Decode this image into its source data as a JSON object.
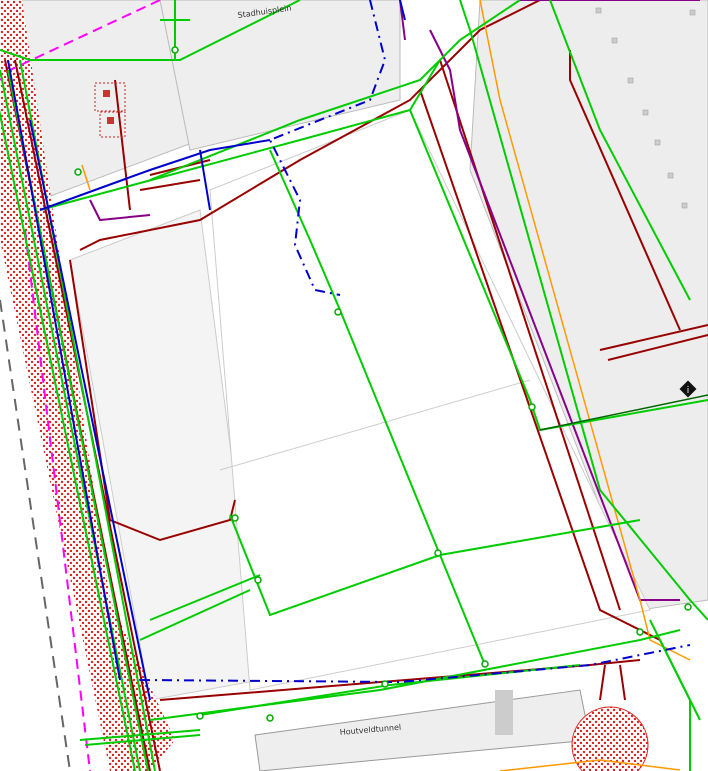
{
  "map": {
    "labels": {
      "stadhuisplein": "Stadhuisplein",
      "houtveldtunnel": "Houtveldtunnel"
    },
    "marker": {
      "symbol": "i"
    },
    "colors": {
      "water": "#00cc00",
      "sewer": "#990000",
      "electric": "#0000cc",
      "telecom": "#880088",
      "gas": "#ff9900",
      "boundary": "#ff00ff",
      "hatch": "#dd2222",
      "building": "#eeeeee",
      "street": "#f4f4f4",
      "marker": "#111111"
    }
  }
}
